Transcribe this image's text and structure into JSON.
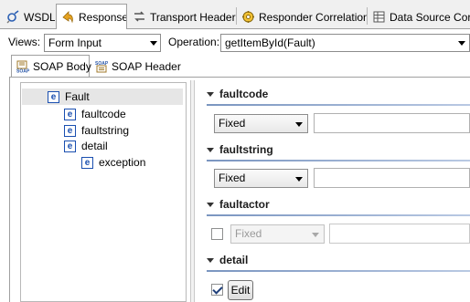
{
  "tabs": [
    {
      "label": "WSDL",
      "icon": "wsdl-icon"
    },
    {
      "label": "Response",
      "icon": "response-icon"
    },
    {
      "label": "Transport Header",
      "icon": "transport-header-icon"
    },
    {
      "label": "Responder Correlation",
      "icon": "responder-correlation-icon"
    },
    {
      "label": "Data Source Corr",
      "icon": "data-source-icon"
    }
  ],
  "toolbar": {
    "views_label": "Views:",
    "views_value": "Form Input",
    "operation_label": "Operation:",
    "operation_value": "getItemById(Fault)"
  },
  "soap_tabs": [
    {
      "label": "SOAP Body",
      "icon": "soap-body-icon"
    },
    {
      "label": "SOAP Header",
      "icon": "soap-header-icon"
    }
  ],
  "tree": {
    "root": "Fault",
    "children": [
      "faultcode",
      "faultstring",
      "detail"
    ],
    "grandchild": "exception"
  },
  "form": {
    "faultcode": {
      "title": "faultcode",
      "mode": "Fixed"
    },
    "faultstring": {
      "title": "faultstring",
      "mode": "Fixed"
    },
    "faultactor": {
      "title": "faultactor",
      "mode": "Fixed",
      "enabled": false
    },
    "detail": {
      "title": "detail",
      "button": "Edit",
      "checked": true
    }
  }
}
